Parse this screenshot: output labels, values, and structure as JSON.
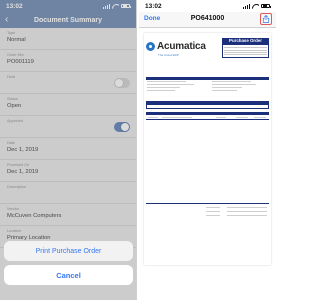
{
  "left_screen": {
    "status": {
      "time": "13:02"
    },
    "nav": {
      "back_glyph": "‹",
      "title": "Document Summary"
    },
    "fields": [
      {
        "label": "Type",
        "value": "Normal",
        "toggle": null
      },
      {
        "label": "Order Nbr.",
        "value": "PO001119",
        "toggle": null
      },
      {
        "label": "Hold",
        "value": "",
        "toggle": "off"
      },
      {
        "label": "Status",
        "value": "Open",
        "toggle": null
      },
      {
        "label": "Approved",
        "value": "",
        "toggle": "on"
      },
      {
        "label": "Date",
        "value": "Dec 1, 2019",
        "toggle": null
      },
      {
        "label": "Promised On",
        "value": "Dec 1, 2019",
        "toggle": null
      },
      {
        "label": "Description",
        "value": "",
        "toggle": null
      },
      {
        "label": "Vendor",
        "value": "McCuven Computers",
        "toggle": null
      },
      {
        "label": "Location",
        "value": "Primary Location",
        "toggle": null
      }
    ],
    "action_sheet": {
      "print_label": "Print Purchase Order",
      "cancel_label": "Cancel"
    },
    "colors": {
      "nav": "#7f97ba",
      "accent": "#3478f6"
    }
  },
  "right_screen": {
    "status": {
      "time": "13:02"
    },
    "nav": {
      "done_label": "Done",
      "title": "PO641000",
      "share_icon": "share-icon"
    },
    "document": {
      "logo_text": "Acumatica",
      "logo_tagline": "The Cloud ERP",
      "header_title": "Purchase Order"
    },
    "colors": {
      "doc_header": "#1c2f7a",
      "highlight": "#e05a5a"
    }
  }
}
